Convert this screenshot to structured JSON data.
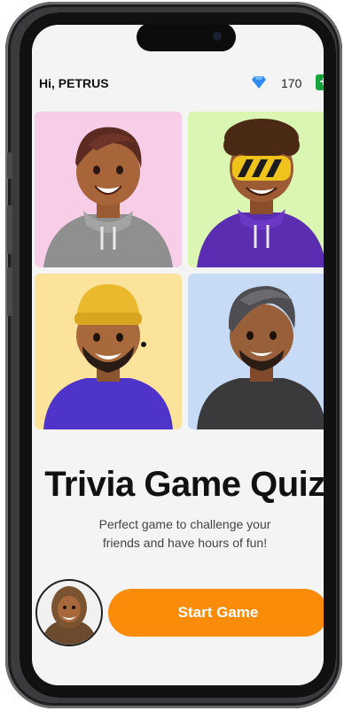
{
  "header": {
    "greeting": "Hi, PETRUS",
    "gem_icon": "diamond-icon",
    "coins": "170",
    "add_icon": "plus-icon"
  },
  "avatars": [
    {
      "bg": "#f7cde8",
      "icon": "avatar-hoodie-gray"
    },
    {
      "bg": "#dbf5b2",
      "icon": "avatar-goggles-purple"
    },
    {
      "bg": "#fbe39b",
      "icon": "avatar-beanie-blue"
    },
    {
      "bg": "#c7dbf6",
      "icon": "avatar-gray-hair-black"
    }
  ],
  "title": "Trivia Game Quiz",
  "subtitle_line1": "Perfect game to challenge your",
  "subtitle_line2": "friends and have hours of fun!",
  "start_button": "Start Game",
  "colors": {
    "accent": "#fb8c0a",
    "plus": "#18a33c",
    "gem": "#2f8bf1"
  }
}
